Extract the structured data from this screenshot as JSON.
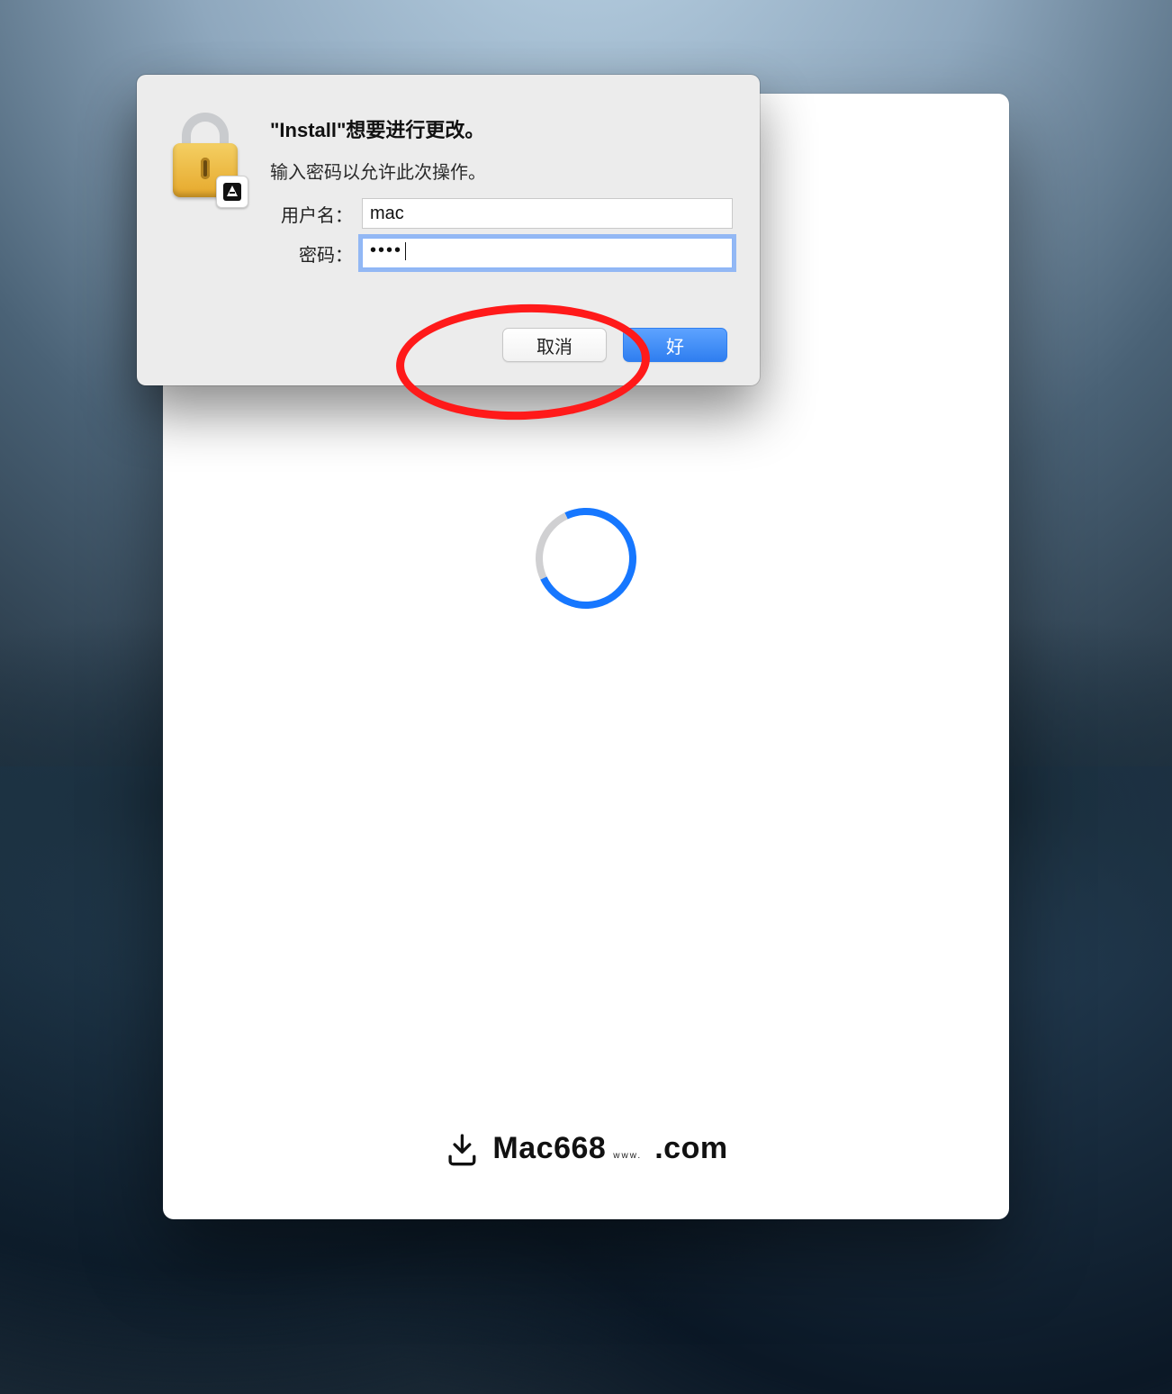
{
  "auth": {
    "title": "\"Install\"想要进行更改。",
    "subtitle": "输入密码以允许此次操作。",
    "username_label": "用户名：",
    "username_value": "mac",
    "password_label": "密码：",
    "password_masked": "••••",
    "cancel_label": "取消",
    "ok_label": "好"
  },
  "brand": {
    "name": "Mac668",
    "www": "www.",
    "com": ".com"
  },
  "colors": {
    "primary": "#2f7ef0",
    "annotation": "#ff1a1a"
  }
}
